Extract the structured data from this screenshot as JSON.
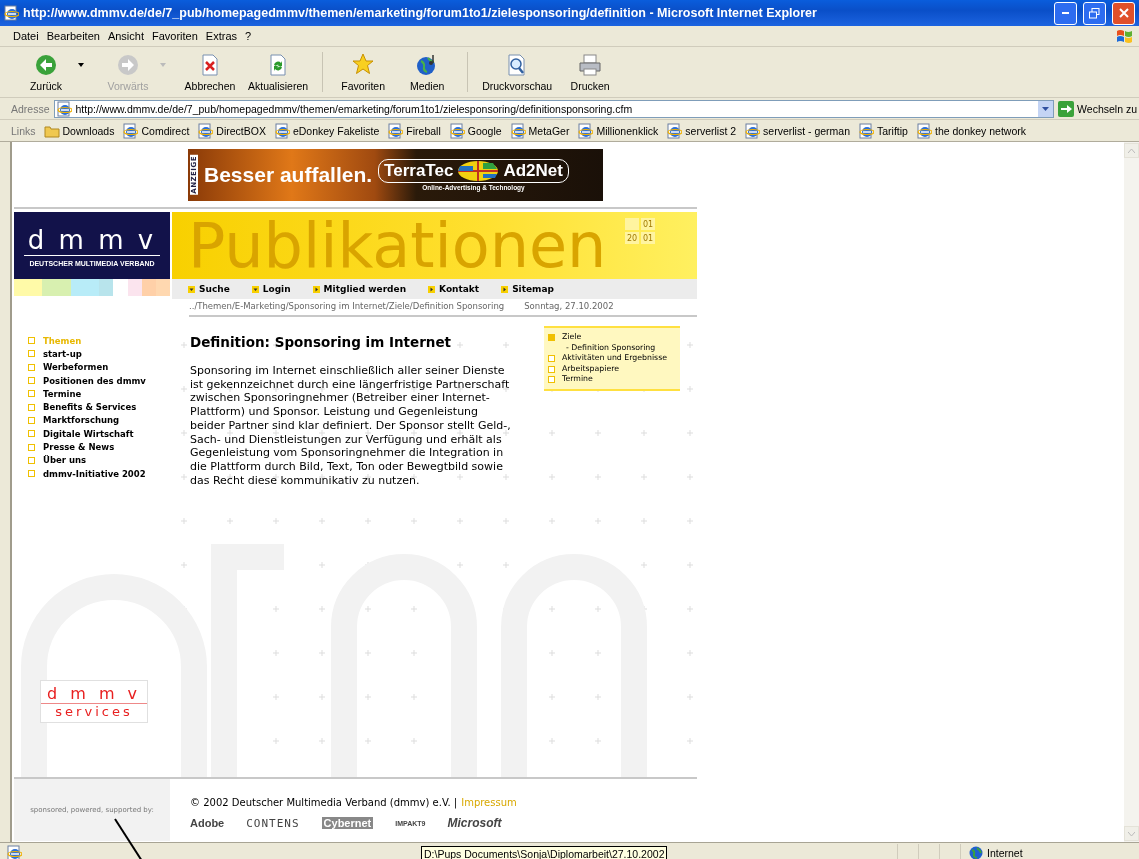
{
  "window": {
    "title": "http://www.dmmv.de/de/7_pub/homepagedmmv/themen/emarketing/forum1to1/zielesponsoring/definition - Microsoft Internet Explorer"
  },
  "menu": [
    "Datei",
    "Bearbeiten",
    "Ansicht",
    "Favoriten",
    "Extras",
    "?"
  ],
  "toolbar": [
    {
      "label": "Zurück",
      "kind": "split",
      "disabled": false
    },
    {
      "label": "Vorwärts",
      "kind": "split",
      "disabled": true
    },
    {
      "label": "Abbrechen",
      "kind": "plain",
      "disabled": false
    },
    {
      "label": "Aktualisieren",
      "kind": "plain",
      "disabled": false
    },
    {
      "label": "Favoriten",
      "kind": "plain",
      "disabled": false
    },
    {
      "label": "Medien",
      "kind": "plain",
      "disabled": false
    },
    {
      "label": "Druckvorschau",
      "kind": "plain",
      "disabled": false
    },
    {
      "label": "Drucken",
      "kind": "plain",
      "disabled": false
    }
  ],
  "address": {
    "label": "Adresse",
    "url": "http://www.dmmv.de/de/7_pub/homepagedmmv/themen/emarketing/forum1to1/zielesponsoring/definitionsponsoring.cfm",
    "go": "Wechseln zu"
  },
  "links": {
    "label": "Links",
    "items": [
      {
        "label": "Downloads",
        "kind": "folder"
      },
      {
        "label": "Comdirect",
        "kind": "page"
      },
      {
        "label": "DirectBOX",
        "kind": "page"
      },
      {
        "label": "eDonkey Fakeliste",
        "kind": "page"
      },
      {
        "label": "Fireball",
        "kind": "page"
      },
      {
        "label": "Google",
        "kind": "page"
      },
      {
        "label": "MetaGer",
        "kind": "page"
      },
      {
        "label": "Millionenklick",
        "kind": "page"
      },
      {
        "label": "serverlist 2",
        "kind": "page"
      },
      {
        "label": "serverlist - german",
        "kind": "page"
      },
      {
        "label": "Tariftip",
        "kind": "page"
      },
      {
        "label": "the donkey network",
        "kind": "page"
      }
    ]
  },
  "ad": {
    "tag": "ANZEIGE",
    "slogan": "Besser auffallen.",
    "brand": "TerraTec",
    "partner": "Ad2Net",
    "claim": "Online-Advertising & Technology"
  },
  "logo": {
    "mark": "d m m v",
    "name": "DEUTSCHER MULTIMEDIA VERBAND"
  },
  "header": {
    "title": "Publikationen",
    "dates": [
      "01",
      "20",
      "01"
    ]
  },
  "nav": [
    {
      "label": "Suche",
      "kind": "down"
    },
    {
      "label": "Login",
      "kind": "down"
    },
    {
      "label": "Mitglied werden",
      "kind": "right"
    },
    {
      "label": "Kontakt",
      "kind": "right"
    },
    {
      "label": "Sitemap",
      "kind": "right"
    }
  ],
  "breadcrumb": "../Themen/E-Marketing/Sponsoring im Internet/Ziele/Definition Sponsoring",
  "date": "Sonntag, 27.10.2002",
  "sidebar": [
    {
      "label": "Themen",
      "selected": true
    },
    {
      "label": "start-up",
      "selected": false
    },
    {
      "label": "Werbeformen",
      "selected": false
    },
    {
      "label": "Positionen des dmmv",
      "selected": false
    },
    {
      "label": "Termine",
      "selected": false
    },
    {
      "label": "Benefits & Services",
      "selected": false
    },
    {
      "label": "Marktforschung",
      "selected": false
    },
    {
      "label": "Digitale Wirtschaft",
      "selected": false
    },
    {
      "label": "Presse & News",
      "selected": false
    },
    {
      "label": "Über uns",
      "selected": false
    },
    {
      "label": "dmmv-Initiative 2002",
      "selected": false
    }
  ],
  "article": {
    "title": "Definition: Sponsoring im Internet",
    "body": "Sponsoring im Internet einschließlich aller seiner Dienste ist gekennzeichnet durch eine längerfristige Partnerschaft zwischen Sponsoringnehmer (Betreiber einer Internet-Plattform) und Sponsor. Leistung und Gegenleistung beider Partner sind klar definiert. Der Sponsor stellt Geld-, Sach- und Dienstleistungen zur Verfügung und erhält als Gegenleistung vom Sponsoringnehmer die Integration in die Plattform durch Bild, Text, Ton oder Bewegtbild sowie das Recht diese kommunikativ zu nutzen."
  },
  "subnav": [
    {
      "label": "Ziele",
      "selected": true,
      "children": [
        {
          "label": "- Definition Sponsoring"
        }
      ]
    },
    {
      "label": "Aktivitäten und Ergebnisse",
      "selected": false
    },
    {
      "label": "Arbeitspapiere",
      "selected": false
    },
    {
      "label": "Termine",
      "selected": false
    }
  ],
  "services_logo": {
    "mark": "d m m v",
    "name": "services"
  },
  "footer": {
    "sponsor_label": "sponsored, powered, supported by:",
    "copyright": "© 2002 Deutscher Multimedia Verband (dmmv) e.V. |",
    "impressum": "Impressum",
    "sponsors": [
      "Adobe",
      "CONTENS",
      "Cybernet",
      "IMPAKT9",
      "Microsoft"
    ]
  },
  "status_bar": {
    "tooltip": "D:\\Pups Documents\\Sonja\\Diplomarbeit\\27.10.2002",
    "zone": "Internet"
  }
}
